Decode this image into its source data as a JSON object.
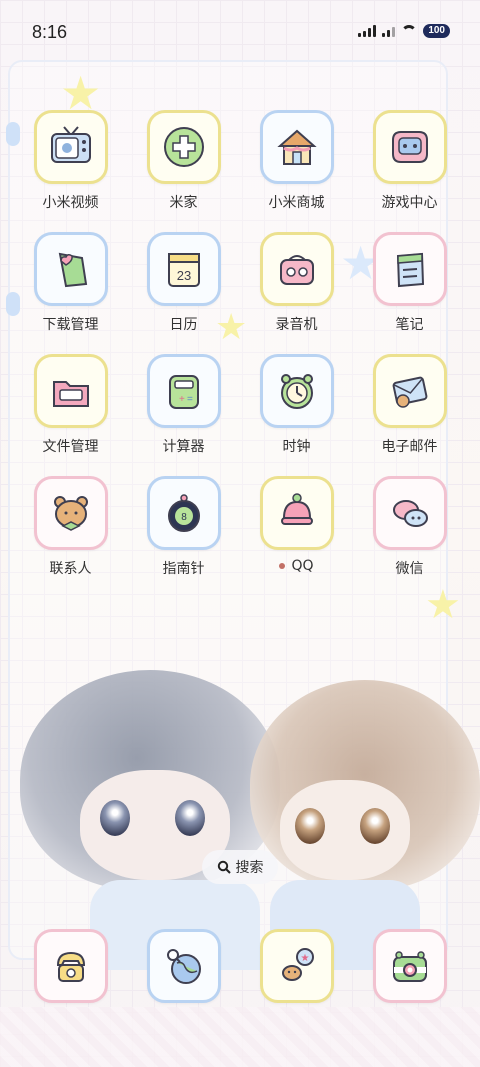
{
  "status_bar": {
    "time": "8:16",
    "battery": "100"
  },
  "apps": [
    [
      {
        "label": "小米视频",
        "icon": "tv-icon",
        "style": "y"
      },
      {
        "label": "米家",
        "icon": "mijia-icon",
        "style": "y"
      },
      {
        "label": "小米商城",
        "icon": "house-shop-icon",
        "style": "b"
      },
      {
        "label": "游戏中心",
        "icon": "gamepad-icon",
        "style": "y"
      }
    ],
    [
      {
        "label": "下载管理",
        "icon": "download-heart-icon",
        "style": "b"
      },
      {
        "label": "日历",
        "icon": "calendar-icon",
        "style": "b"
      },
      {
        "label": "录音机",
        "icon": "recorder-icon",
        "style": "y"
      },
      {
        "label": "笔记",
        "icon": "notes-icon",
        "style": "p"
      }
    ],
    [
      {
        "label": "文件管理",
        "icon": "folder-icon",
        "style": "y"
      },
      {
        "label": "计算器",
        "icon": "calculator-icon",
        "style": "b"
      },
      {
        "label": "时钟",
        "icon": "clock-icon",
        "style": "b"
      },
      {
        "label": "电子邮件",
        "icon": "mail-icon",
        "style": "y"
      }
    ],
    [
      {
        "label": "联系人",
        "icon": "bear-contact-icon",
        "style": "p"
      },
      {
        "label": "指南针",
        "icon": "compass-icon",
        "style": "b"
      },
      {
        "label": "QQ",
        "icon": "qq-icon",
        "style": "y",
        "new_dot": true
      },
      {
        "label": "微信",
        "icon": "wechat-icon",
        "style": "p"
      }
    ]
  ],
  "search": {
    "label": "搜索"
  },
  "dock": [
    {
      "icon": "phone-icon",
      "style": "p"
    },
    {
      "icon": "browser-globe-icon",
      "style": "b"
    },
    {
      "icon": "messages-icon",
      "style": "y"
    },
    {
      "icon": "camera-icon",
      "style": "p"
    }
  ],
  "colors": {
    "tile_yellow": "#ece18f",
    "tile_blue": "#b9d3f2",
    "tile_pink": "#f2c2d0",
    "new_dot": "#c27066"
  }
}
